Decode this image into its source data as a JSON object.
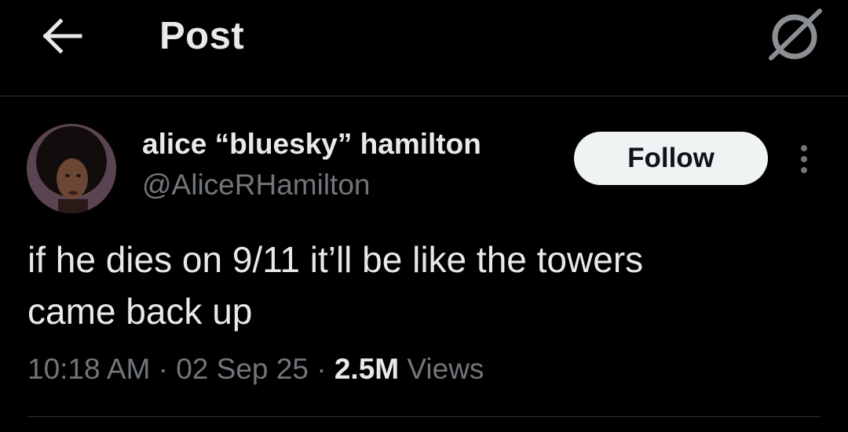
{
  "header": {
    "title": "Post",
    "back_icon": "arrow-left-icon",
    "grok_icon": "grok-icon"
  },
  "post": {
    "author": {
      "display_name": "alice “bluesky” hamilton",
      "handle": "@AliceRHamilton"
    },
    "follow_label": "Follow",
    "text_line1": "if he dies on 9/11 it’ll be like the towers",
    "text_line2": "came back up",
    "time": "10:18 AM",
    "date": "02 Sep 25",
    "separator": "·",
    "views_count": "2.5M",
    "views_label": "Views"
  },
  "colors": {
    "background": "#000000",
    "primary_text": "#e7e9ea",
    "secondary_text": "#71767b",
    "divider": "#2f3336",
    "follow_bg": "#eff3f4"
  }
}
